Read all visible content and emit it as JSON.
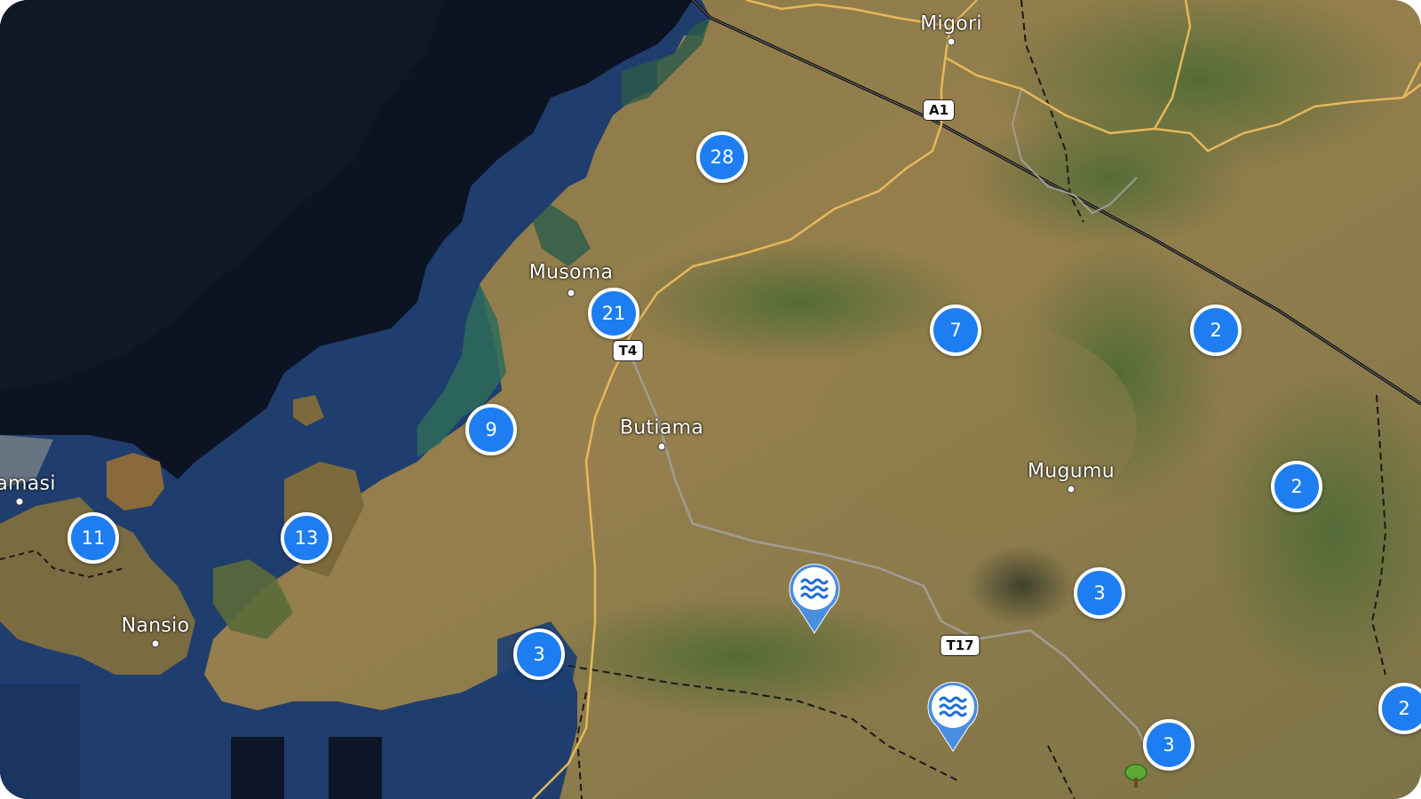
{
  "map": {
    "type": "satellite",
    "place_labels": [
      {
        "id": "migori",
        "text": "Migori"
      },
      {
        "id": "musoma",
        "text": "Musoma"
      },
      {
        "id": "butiama",
        "text": "Butiama"
      },
      {
        "id": "mugumu",
        "text": "Mugumu"
      },
      {
        "id": "nansio",
        "text": "Nansio"
      },
      {
        "id": "kamasi",
        "text": "amasi"
      }
    ],
    "road_shields": [
      {
        "id": "a1",
        "text": "A1"
      },
      {
        "id": "t4",
        "text": "T4"
      },
      {
        "id": "t17",
        "text": "T17"
      }
    ],
    "clusters": [
      {
        "id": "c28",
        "count": "28"
      },
      {
        "id": "c21",
        "count": "21"
      },
      {
        "id": "c7",
        "count": "7"
      },
      {
        "id": "c2a",
        "count": "2"
      },
      {
        "id": "c9",
        "count": "9"
      },
      {
        "id": "c2b",
        "count": "2"
      },
      {
        "id": "c11",
        "count": "11"
      },
      {
        "id": "c13",
        "count": "13"
      },
      {
        "id": "c3a",
        "count": "3"
      },
      {
        "id": "c3b",
        "count": "3"
      },
      {
        "id": "c3c",
        "count": "3"
      },
      {
        "id": "c2c",
        "count": "2"
      }
    ],
    "markers": [
      {
        "id": "water1",
        "icon": "water-waves-icon"
      },
      {
        "id": "water2",
        "icon": "water-waves-icon"
      },
      {
        "id": "tree1",
        "icon": "tree-icon"
      }
    ],
    "colors": {
      "cluster": "#1e7df0",
      "cluster_border": "#ffffff",
      "water_marker": "#4a8ee0",
      "road": "#e6b85a",
      "border_line": "#111111"
    }
  }
}
